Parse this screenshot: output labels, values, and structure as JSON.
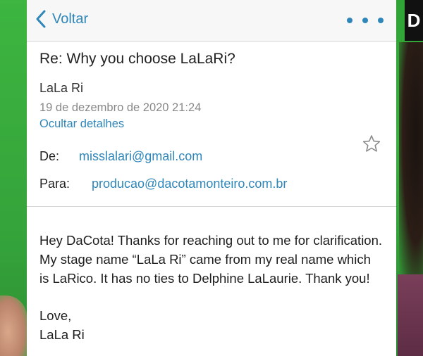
{
  "navbar": {
    "back_label": "Voltar"
  },
  "email": {
    "subject": "Re: Why you choose LaLaRi?",
    "sender_name": "LaLa Ri",
    "date": "19 de dezembro de 2020 21:24",
    "toggle_details": "Ocultar detalhes",
    "from_label": "De:",
    "from_address": "misslalari@gmail.com",
    "to_label": "Para:",
    "to_address": "producao@dacotamonteiro.com.br",
    "body": "Hey DaCota! Thanks for reaching out to me for clarification. My stage name “LaLa Ri” came from my real name which is LaRico. It has no ties to Delphine LaLaurie. Thank you!",
    "closing": "Love,",
    "signature": "LaLa Ri"
  },
  "overlay": {
    "logo_letter": "D"
  },
  "colors": {
    "accent": "#2f86b8",
    "green_screen": "#3aa63e"
  }
}
